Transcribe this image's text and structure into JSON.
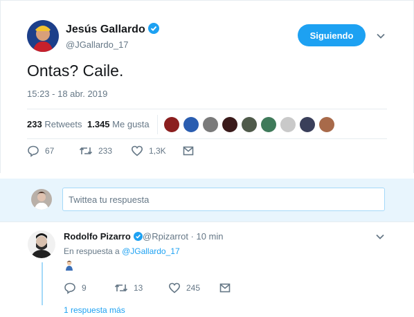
{
  "tweet": {
    "author_name": "Jesús Gallardo",
    "author_handle": "@JGallardo_17",
    "follow_label": "Siguiendo",
    "text": "Ontas? Caile.",
    "timestamp": "15:23 - 18 abr. 2019",
    "retweets_count": "233",
    "retweets_label": "Retweets",
    "likes_count": "1.345",
    "likes_label": "Me gusta",
    "actions": {
      "replies": "67",
      "retweets": "233",
      "likes": "1,3K"
    }
  },
  "reply_box": {
    "placeholder": "Twittea tu respuesta"
  },
  "reply": {
    "author_name": "Rodolfo Pizarro",
    "meta": "@Rpizarrot · 10 min",
    "in_reply_prefix": "En respuesta a",
    "in_reply_handle": "@JGallardo_17",
    "actions": {
      "replies": "9",
      "retweets": "13",
      "likes": "245"
    },
    "more_replies": "1 respuesta más"
  },
  "colors": {
    "accent": "#1da1f2",
    "secondary_text": "#657786",
    "reply_area_bg": "#e8f5fd"
  }
}
